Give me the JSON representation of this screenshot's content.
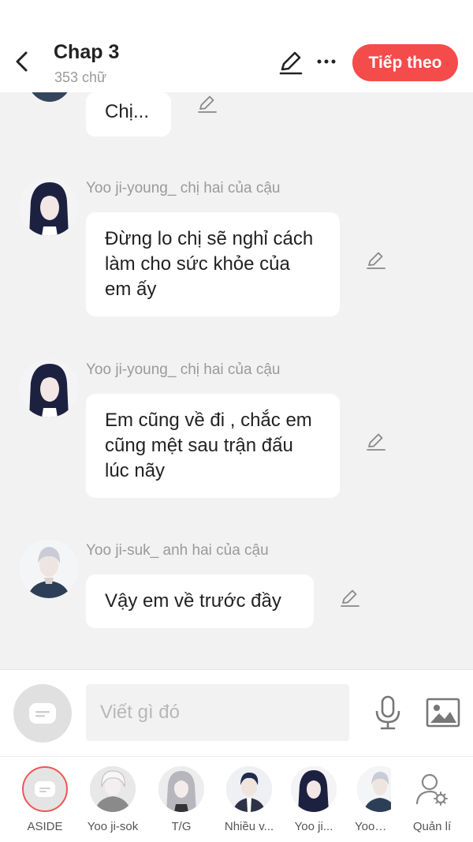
{
  "header": {
    "title": "Chap 3",
    "subtitle": "353 chữ",
    "next_label": "Tiếp theo"
  },
  "messages": [
    {
      "sender": "",
      "text": "Chị...",
      "avatar": "navy-avatar"
    },
    {
      "sender": "Yoo ji-young_ chị hai của cậu",
      "text": "Đừng lo chị sẽ nghỉ cách làm cho sức khỏe của em ấy",
      "avatar": "dark-hair-girl"
    },
    {
      "sender": "Yoo ji-young_ chị hai của cậu",
      "text": "Em cũng về đi , chắc em cũng mệt sau trận đấu lúc nãy",
      "avatar": "dark-hair-girl"
    },
    {
      "sender": "Yoo ji-suk_ anh hai của cậu",
      "text": "Vậy em về trước đầy",
      "avatar": "silver-hair-boy"
    }
  ],
  "input": {
    "placeholder": "Viết gì đó"
  },
  "characters": [
    {
      "label": "ASIDE",
      "icon": "aside-chat-icon"
    },
    {
      "label": "Yoo ji-sok",
      "icon": "white-hair-character"
    },
    {
      "label": "T/G",
      "icon": "gray-hair-girl"
    },
    {
      "label": "Nhiều v...",
      "icon": "suit-boy"
    },
    {
      "label": "Yoo ji...",
      "icon": "dark-hair-girl"
    },
    {
      "label": "Yoo ji...",
      "icon": "silver-hair-boy"
    },
    {
      "label": "Quản lí",
      "icon": "user-settings-icon"
    }
  ],
  "colors": {
    "accent": "#f44b4b",
    "background": "#f2f2f2"
  }
}
